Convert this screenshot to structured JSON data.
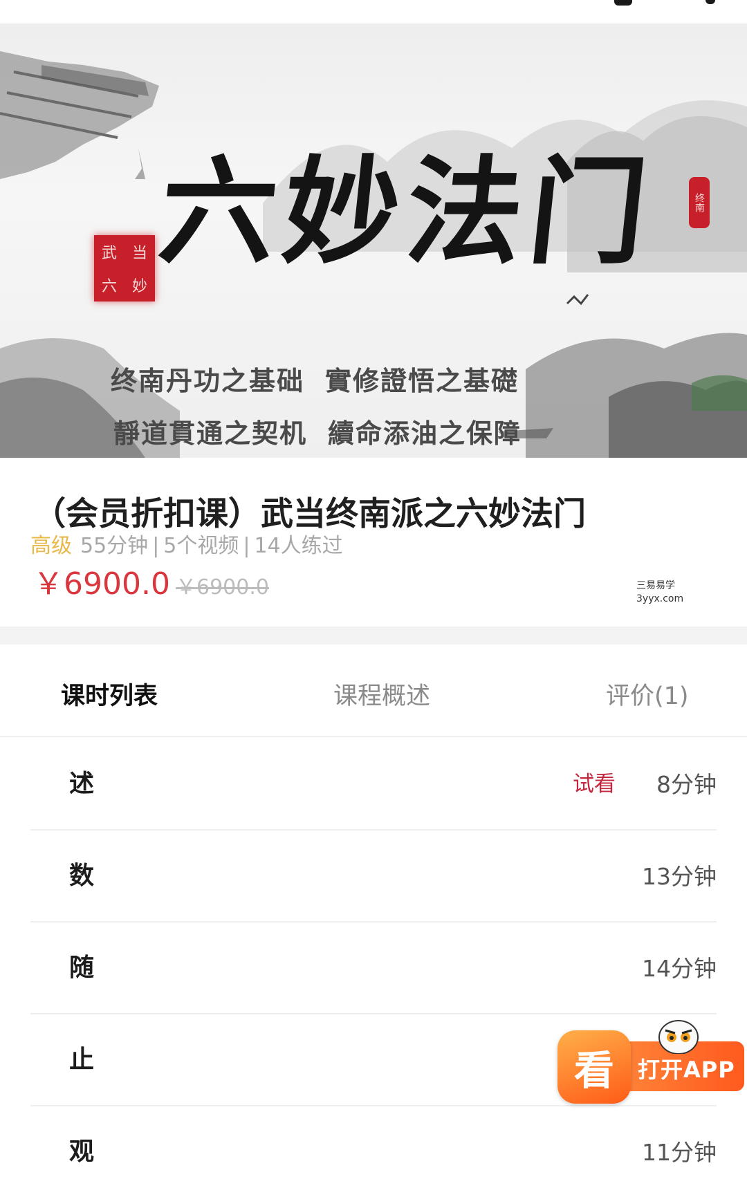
{
  "banner": {
    "title": "六妙法门",
    "seal_left": [
      "武",
      "当",
      "六",
      "妙"
    ],
    "seal_right": "终南",
    "taglines": [
      "终南丹功之基础",
      "實修證悟之基礎",
      "靜道貫通之契机",
      "續命添油之保障"
    ]
  },
  "course": {
    "title": "（会员折扣课）武当终南派之六妙法门",
    "level": "高级",
    "duration": "55分钟",
    "videos": "5个视频",
    "learners": "14人练过",
    "separator": "|",
    "price": "￥6900.0",
    "original_price": "￥6900.0"
  },
  "watermark": {
    "cn": "三易易学",
    "en": "3yyx.com"
  },
  "tabs": [
    {
      "label": "课时列表",
      "active": true
    },
    {
      "label": "课程概述",
      "active": false
    },
    {
      "label": "评价(1)",
      "active": false
    }
  ],
  "lessons": [
    {
      "name": "述",
      "trial": "试看",
      "duration": "8分钟"
    },
    {
      "name": "数",
      "trial": "",
      "duration": "13分钟"
    },
    {
      "name": "随",
      "trial": "",
      "duration": "14分钟"
    },
    {
      "name": "止",
      "trial": "",
      "duration": ""
    },
    {
      "name": "观",
      "trial": "",
      "duration": "11分钟"
    }
  ],
  "open_app": {
    "logo_char": "看",
    "label": "打开APP"
  },
  "colors": {
    "accent_red": "#d9363e",
    "level_gold": "#e8b84a",
    "app_orange": "#ff6a24"
  }
}
